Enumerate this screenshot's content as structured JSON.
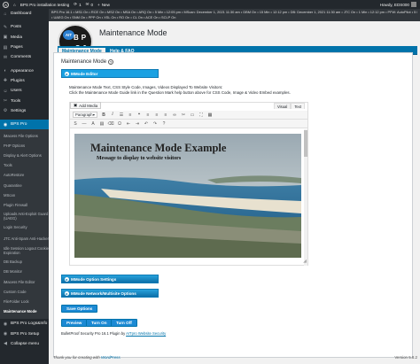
{
  "adminbar": {
    "site_name": "BPS Pro installation testing",
    "updates_count": "1",
    "comments_count": "0",
    "new_label": "New",
    "howdy": "Howdy, EDS000"
  },
  "statusbar": {
    "line1": "BPS Pro 16.1 • MS1 On • RCE On • MS2 On • MSA On • ARQ On • 5 Min • 12:05 pm • MScan: December 1, 2021 11:30 am • DBM On • 15 Min • 12:12 pm • DB: December 1, 2021 11:30 am • JTC On • 1 Min • 12:12 pm • PFW: AutoPilot • 5 Min • 12:12 pm • LSM On",
    "line2": "• UAEG On • SNM On • PPP On • XSL On • RO On • CL On • ACE On • SCLP On"
  },
  "sidebar": {
    "items": [
      {
        "label": "Dashboard",
        "icon": "⌂"
      },
      {
        "label": "Posts",
        "icon": "✎"
      },
      {
        "label": "Media",
        "icon": "▣"
      },
      {
        "label": "Pages",
        "icon": "▤"
      },
      {
        "label": "Comments",
        "icon": "✉"
      },
      {
        "label": "Appearance",
        "icon": "◐"
      },
      {
        "label": "Plugins",
        "icon": "✚"
      },
      {
        "label": "Users",
        "icon": "☺"
      },
      {
        "label": "Tools",
        "icon": "✂"
      },
      {
        "label": "Settings",
        "icon": "⚙"
      },
      {
        "label": "BPS Pro",
        "icon": "◉"
      }
    ],
    "submenu": [
      "iMacess File Options",
      "PHP Options",
      "Display & Alert Options",
      "Tools",
      "AutoRestore",
      "Quarantine",
      "MScan",
      "Plugin Firewall",
      "Uploads Anti-Exploit Guard (UAEG)",
      "Login Security",
      "JTC Anti-Spam Anti-Hacker",
      "Idle Session Logout Cookie Expiration",
      "DB Backup",
      "DB Monitor",
      "iMacess File Editor",
      "Custom Code",
      "FileFolder Lock",
      "Maintenance Mode"
    ],
    "bottom": [
      {
        "label": "BPS Pro Logs&Info",
        "icon": "◉"
      },
      {
        "label": "BPS Pro Setup",
        "icon": "◉"
      },
      {
        "label": "Collapse menu",
        "icon": "◀"
      }
    ]
  },
  "logo": {
    "badge": "AIT",
    "line1": "BP",
    "line2": "S0"
  },
  "page": {
    "title": "Maintenance Mode",
    "tabs": [
      "Maintenance Mode",
      "Help & FAQ"
    ],
    "section_title": "Maintenance Mode",
    "help_icon": "?",
    "mmode_editor": "MMode Editor",
    "help_text_1": "Maintenance Mode Text, CSS Style Code, Images, Videos Displayed To Website Visitors:",
    "help_text_2": "Click the Maintenance Mode Guide link in the Question Mark help button above for CSS Code, Image & Video Embed examples."
  },
  "editor": {
    "add_media": "Add Media",
    "tab_visual": "Visual",
    "tab_text": "Text",
    "format_select": "Paragraph",
    "image_headline": "Maintenance Mode Example",
    "image_subline": "Message to display to website visitors"
  },
  "buttons": {
    "mmode_options": "MMode Option Settings",
    "mmode_network": "MMode Network/Multisite Options",
    "save_options": "Save Options",
    "preview": "Preview",
    "turn_on": "Turn On",
    "turn_off": "Turn Off"
  },
  "footer": {
    "plugin_prefix": "BulletProof Security Pro 16.1 Plugin by ",
    "plugin_link": "AITpro Website Security",
    "thanks_prefix": "Thank you for creating with ",
    "thanks_link": "WordPress",
    "version": "Version 5.8.2"
  },
  "colors": {
    "admin_blue": "#0073aa",
    "button_blue": "#1ba1e2",
    "admin_dark": "#23282d"
  }
}
